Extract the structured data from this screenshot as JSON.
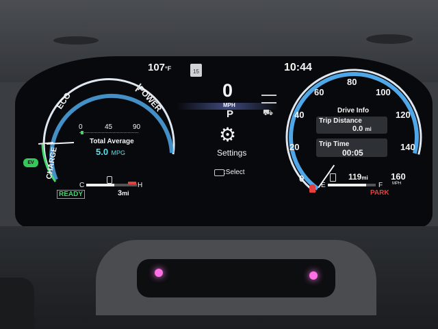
{
  "status_bar": {
    "temperature": "107",
    "temperature_unit": "°F",
    "calendar_day": "15",
    "clock": "10:44"
  },
  "left_gauge": {
    "zone_eco": "ECO",
    "zone_power": "POWER",
    "zone_charge": "CHARGE",
    "scale": [
      "0",
      "45",
      "90"
    ],
    "average_label": "Total Average",
    "average_value": "5.0",
    "average_unit": "MPG",
    "temp_cold": "C",
    "temp_hot": "H",
    "ev_badge": "EV",
    "ready_badge": "READY",
    "range_value": "3",
    "range_unit": "mi"
  },
  "center": {
    "speed": "0",
    "speed_unit": "MPH",
    "gear": "P",
    "settings_label": "Settings",
    "select_hint": ":Select"
  },
  "speedometer": {
    "ticks": [
      "0",
      "20",
      "40",
      "60",
      "80",
      "100",
      "120",
      "140",
      "160"
    ],
    "unit": "MPH",
    "needle_value": 0,
    "max_value": 160,
    "drive_info_title": "Drive Info",
    "trip_distance_label": "Trip Distance",
    "trip_distance_value": "0.0",
    "trip_distance_unit": "mi",
    "trip_time_label": "Trip Time",
    "trip_time_value": "00:05",
    "fuel_range_value": "119",
    "fuel_range_unit": "mi",
    "fuel_empty": "E",
    "fuel_full": "F",
    "fuel_level": 0.8,
    "park_label": "PARK"
  },
  "colors": {
    "gauge_blue": "#4fa7e8",
    "accent_green": "#43d66a",
    "warning_red": "#e54040"
  }
}
